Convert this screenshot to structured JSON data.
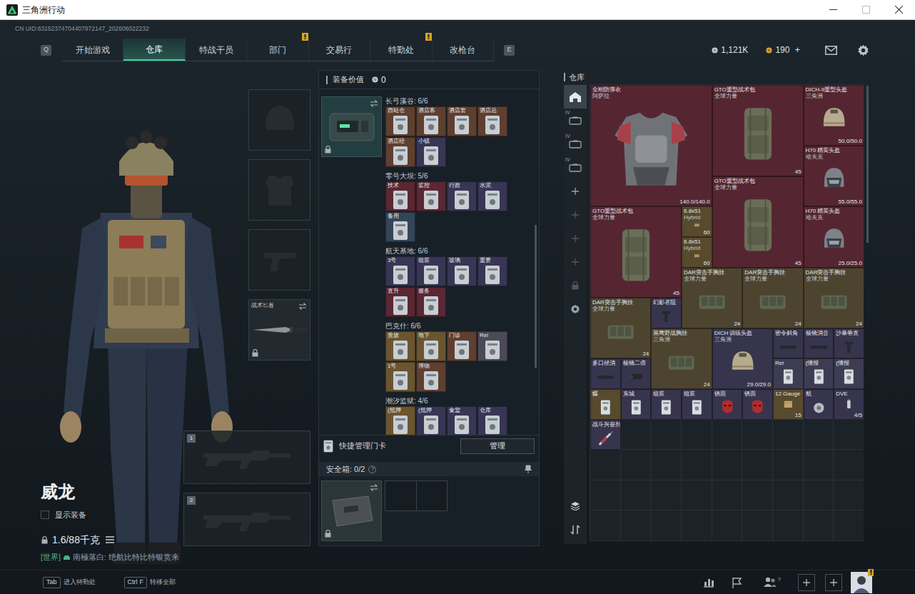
{
  "window": {
    "title": "三角洲行动"
  },
  "uid": "CN UID:63152374704407972147_202606022232",
  "nav": {
    "prev_key": "Q",
    "next_key": "E",
    "tabs": [
      {
        "label": "开始游戏",
        "selected": false,
        "alert": false
      },
      {
        "label": "仓库",
        "selected": true,
        "alert": false
      },
      {
        "label": "特战干员",
        "selected": false,
        "alert": false
      },
      {
        "label": "部门",
        "selected": false,
        "alert": true
      },
      {
        "label": "交易行",
        "selected": false,
        "alert": false
      },
      {
        "label": "特勤处",
        "selected": false,
        "alert": true
      },
      {
        "label": "改枪台",
        "selected": false,
        "alert": false
      }
    ]
  },
  "currency": [
    {
      "amount": "1,121K",
      "kind": "silver"
    },
    {
      "amount": "190",
      "kind": "gold",
      "plus": "+"
    }
  ],
  "operator": {
    "name": "威龙",
    "show_gear": {
      "label": "显示装备",
      "checked": false
    },
    "weight": "1.6/88千克"
  },
  "chat": {
    "channel": "[世界]",
    "text": "南極落白: 绝航比特比特银赏来"
  },
  "equipment_slots": [
    {
      "kind": "helmet",
      "filled": false
    },
    {
      "kind": "armor",
      "filled": false
    },
    {
      "kind": "pistol",
      "filled": false
    },
    {
      "kind": "knife",
      "filled": true,
      "label": "战术匕首",
      "locked": true
    }
  ],
  "weapon_slots": [
    {
      "number": "1",
      "filled": false
    },
    {
      "number": "2",
      "filled": false
    }
  ],
  "loadout": {
    "value_label": "装备价值",
    "value": "0",
    "keycard_case": {
      "locked": true
    },
    "key_groups": [
      {
        "map": "长弓溪谷: 6/6",
        "cards": [
          {
            "label": "西站仓",
            "color": "#5e3f30"
          },
          {
            "label": "酒店客",
            "color": "#5e3f30"
          },
          {
            "label": "酒店套",
            "color": "#5e3f30"
          },
          {
            "label": "酒店总",
            "color": "#5e3f30"
          },
          {
            "label": "酒店经",
            "color": "#5e3f30"
          },
          {
            "label": "小镇",
            "color": "#383654"
          }
        ]
      },
      {
        "map": "零号大坝: 5/6",
        "cards": [
          {
            "label": "技术",
            "color": "#5a2733"
          },
          {
            "label": "监控",
            "color": "#5a2733"
          },
          {
            "label": "行政",
            "color": "#383654"
          },
          {
            "label": "水泥",
            "color": "#383654"
          },
          {
            "label": "备用",
            "color": "#344559"
          }
        ]
      },
      {
        "map": "航天基地: 6/6",
        "cards": [
          {
            "label": "3号",
            "color": "#383654"
          },
          {
            "label": "组装",
            "color": "#383654"
          },
          {
            "label": "玻璃",
            "color": "#383654"
          },
          {
            "label": "重要",
            "color": "#383654"
          },
          {
            "label": "直升",
            "color": "#5a2733"
          },
          {
            "label": "服务",
            "color": "#5a2733"
          }
        ]
      },
      {
        "map": "巴克什: 6/6",
        "cards": [
          {
            "label": "贵族",
            "color": "#6a5530"
          },
          {
            "label": "地下",
            "color": "#6a5530"
          },
          {
            "label": "门诊",
            "color": "#5e3f30"
          },
          {
            "label": "Rei",
            "color": "#4a4a58"
          },
          {
            "label": "1号",
            "color": "#6a5530"
          },
          {
            "label": "博物",
            "color": "#5e3f30"
          }
        ]
      },
      {
        "map": "潮汐监狱: 4/6",
        "cards": [
          {
            "label": "(抵押",
            "color": "#6a5530"
          },
          {
            "label": "(抵押",
            "color": "#383654"
          },
          {
            "label": "食堂",
            "color": "#383654"
          },
          {
            "label": "仓库",
            "color": "#383654"
          }
        ]
      }
    ],
    "quick_manage": {
      "label": "快捷管理门卡",
      "button": "管理"
    },
    "safe_box": {
      "label": "安全箱: 0/2",
      "help": "?",
      "locked": true,
      "slots": [
        {
          "filled": false
        },
        {
          "filled": false
        }
      ]
    }
  },
  "warehouse": {
    "title": "仓库",
    "sidebar": [
      {
        "kind": "home",
        "selected": true,
        "disabled": false
      },
      {
        "kind": "case",
        "selected": false,
        "disabled": false,
        "tag": "IV"
      },
      {
        "kind": "case",
        "selected": false,
        "disabled": false,
        "tag": "IV"
      },
      {
        "kind": "case",
        "selected": false,
        "disabled": false,
        "tag": "IV"
      },
      {
        "kind": "add",
        "selected": false,
        "disabled": false
      },
      {
        "kind": "add",
        "selected": false,
        "disabled": true
      },
      {
        "kind": "add",
        "selected": false,
        "disabled": true
      },
      {
        "kind": "add",
        "selected": false,
        "disabled": true
      },
      {
        "kind": "lock",
        "selected": false,
        "disabled": true
      },
      {
        "kind": "settings",
        "selected": false,
        "disabled": false
      },
      {
        "kind": "layers",
        "selected": false,
        "disabled": false
      },
      {
        "kind": "sort",
        "selected": false,
        "disabled": false
      }
    ],
    "items": [
      {
        "name": "金刚防弹衣",
        "sub": "阿萨拉",
        "value": "140.0/140.0",
        "kind": "armor",
        "color": "#552631"
      },
      {
        "name": "GTO重型战术包",
        "sub": "全球力量",
        "value": "45",
        "kind": "backpack",
        "color": "#552631"
      },
      {
        "name": "DICH-9重型头盔",
        "sub": "三角洲",
        "value": "50.0/50.0",
        "kind": "helmet",
        "color": "#552631"
      },
      {
        "name": "H70 精英头盔",
        "sub": "哈夫克",
        "value": "55.0/55.0",
        "kind": "visor",
        "color": "#552631"
      },
      {
        "name": "GTO重型战术包",
        "sub": "全球力量",
        "value": "45",
        "kind": "backpack",
        "color": "#552631"
      },
      {
        "name": "GTO重型战术包",
        "sub": "全球力量",
        "value": "45",
        "kind": "backpack",
        "color": "#552631"
      },
      {
        "name": "H70 精英头盔",
        "sub": "哈夫克",
        "value": "25.0/25.0",
        "kind": "visor",
        "color": "#552631"
      },
      {
        "name": "6.8x51",
        "sub": "Hybrid",
        "value": "60",
        "kind": "ammo",
        "color": "#574a2d"
      },
      {
        "name": "6.8x51",
        "sub": "Hybrid",
        "value": "60",
        "kind": "ammo",
        "color": "#574a2d"
      },
      {
        "name": "DAR突击手胸挂",
        "sub": "全球力量",
        "value": "24",
        "kind": "rig",
        "color": "#4d4430"
      },
      {
        "name": "DAR突击手胸挂",
        "sub": "全球力量",
        "value": "24",
        "kind": "rig",
        "color": "#4d4430"
      },
      {
        "name": "DAR突击手胸挂",
        "sub": "全球力量",
        "value": "24",
        "kind": "rig",
        "color": "#4d4430"
      },
      {
        "name": "DAR突击手胸挂",
        "sub": "全球力量",
        "value": "24",
        "kind": "rig",
        "color": "#4d4430"
      },
      {
        "name": "幻影者阻",
        "kind": "grip",
        "color": "#37344d"
      },
      {
        "name": "黑鹰野战胸挂",
        "sub": "三角洲",
        "value": "24",
        "kind": "rig",
        "color": "#4d4430"
      },
      {
        "name": "DICH 训练头盔",
        "sub": "三角洲",
        "value": "29.0/29.0",
        "kind": "helmet",
        "color": "#37344d"
      },
      {
        "name": "密令斜角",
        "kind": "attachment",
        "color": "#37344d"
      },
      {
        "name": "棱镜消音",
        "kind": "attachment",
        "color": "#37344d"
      },
      {
        "name": "沙暴垂直",
        "kind": "grip",
        "color": "#37344d"
      },
      {
        "name": "多口径消",
        "kind": "attachment",
        "color": "#37344d"
      },
      {
        "name": "棱镜二倍",
        "kind": "scope",
        "color": "#37344d"
      },
      {
        "name": "Rei",
        "kind": "card",
        "color": "#3d3c52"
      },
      {
        "name": "(情报",
        "kind": "card",
        "color": "#3d3c52"
      },
      {
        "name": "(情报",
        "kind": "card",
        "color": "#3d3c52"
      },
      {
        "name": "蝶",
        "kind": "card",
        "color": "#574a2d"
      },
      {
        "name": "东城",
        "kind": "card",
        "color": "#37344d"
      },
      {
        "name": "组装",
        "kind": "card",
        "color": "#37344d"
      },
      {
        "name": "组装",
        "kind": "card",
        "color": "#37344d"
      },
      {
        "name": "锈面",
        "kind": "mask",
        "color": "#37344d"
      },
      {
        "name": "锈面",
        "kind": "mask",
        "color": "#37344d"
      },
      {
        "name": "12 Gauge",
        "value": "15",
        "kind": "box",
        "color": "#574a2d"
      },
      {
        "name": "航",
        "kind": "part",
        "color": "#37344d"
      },
      {
        "name": "DVE",
        "value": "4/5",
        "kind": "battery",
        "color": "#37344d"
      },
      {
        "name": "战斗兴奋剂",
        "kind": "syringe",
        "color": "#37344d"
      }
    ]
  },
  "bottom_bar": {
    "hints": [
      {
        "keys": [
          "Tab"
        ],
        "label": "进入特勤处"
      },
      {
        "keys": [
          "Ctrl",
          "F"
        ],
        "label": "转移全部"
      }
    ],
    "friends_count": "?",
    "avatar_alert": true
  }
}
